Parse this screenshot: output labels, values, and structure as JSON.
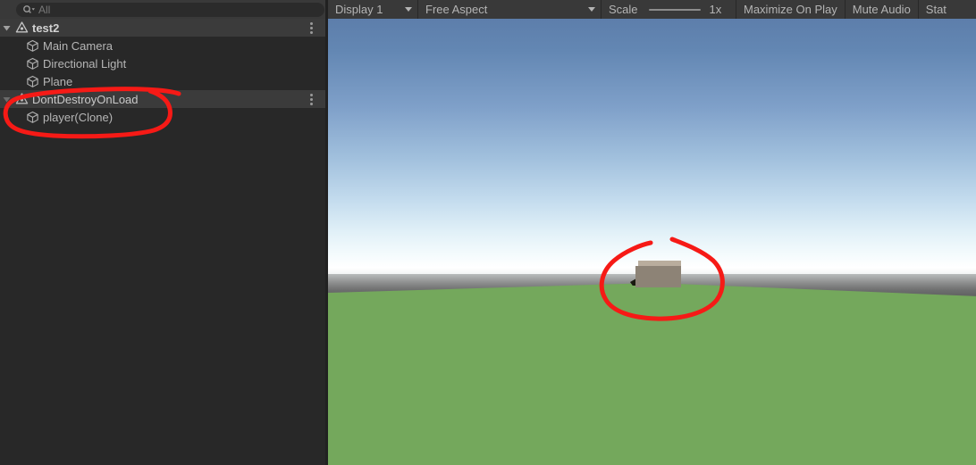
{
  "hierarchy": {
    "search": {
      "value": "All",
      "icon": "search-icon"
    },
    "rows": [
      {
        "label": "test2",
        "icon": "unity-scene-icon",
        "depth": 0,
        "type": "scene",
        "expanded": true,
        "has_menu": true,
        "bold": true
      },
      {
        "label": "Main Camera",
        "icon": "gameobject-cube-icon",
        "depth": 1,
        "type": "gameobject",
        "expanded": false,
        "has_menu": false,
        "bold": false
      },
      {
        "label": "Directional Light",
        "icon": "gameobject-cube-icon",
        "depth": 1,
        "type": "gameobject",
        "expanded": false,
        "has_menu": false,
        "bold": false
      },
      {
        "label": "Plane",
        "icon": "gameobject-cube-icon",
        "depth": 1,
        "type": "gameobject",
        "expanded": false,
        "has_menu": false,
        "bold": false
      },
      {
        "label": "DontDestroyOnLoad",
        "icon": "unity-scene-icon",
        "depth": 0,
        "type": "scene",
        "expanded": true,
        "has_menu": true,
        "bold": false
      },
      {
        "label": "player(Clone)",
        "icon": "gameobject-cube-icon",
        "depth": 1,
        "type": "gameobject",
        "expanded": false,
        "has_menu": false,
        "bold": false
      }
    ]
  },
  "game_toolbar": {
    "display": {
      "label": "Display 1",
      "caret": "chevron-down-icon"
    },
    "aspect": {
      "label": "Free Aspect",
      "caret": "chevron-down-icon"
    },
    "scale": {
      "label": "Scale",
      "value": "1x"
    },
    "maximize_on_play": "Maximize On Play",
    "mute_audio": "Mute Audio",
    "stats": "Stat"
  },
  "game_view": {
    "sky_top_color": "#5d7eab",
    "sky_horizon_color": "#ffffff",
    "ground_color": "#74a85c",
    "fog_band_color": "#6d6e6e",
    "cube_top_color": "#b9ad9d",
    "cube_front_color": "#8d8376",
    "shadow_color": "#19190f"
  },
  "annotations": {
    "color": "#f61a16",
    "stroke_width": 5,
    "items": [
      {
        "name": "hierarchy-circle",
        "target": "DontDestroyOnLoad and player(Clone) rows"
      },
      {
        "name": "gameview-circle",
        "target": "player cube in game view"
      }
    ]
  }
}
